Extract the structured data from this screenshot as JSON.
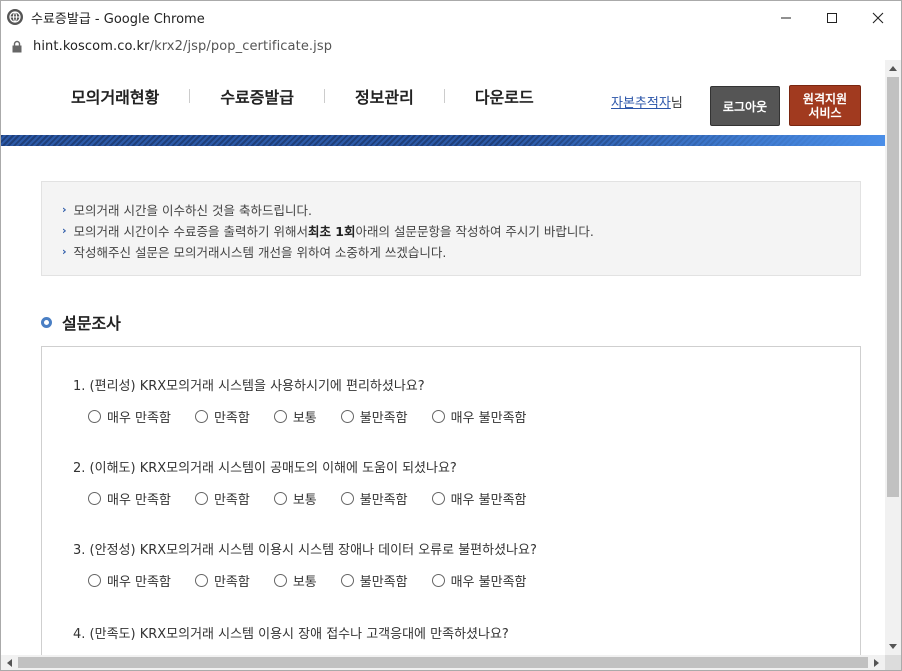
{
  "window": {
    "title": "수료증발급 - Google Chrome",
    "url_host": "hint.koscom.co.kr",
    "url_path": "/krx2/jsp/pop_certificate.jsp"
  },
  "nav": {
    "items": [
      "모의거래현황",
      "수료증발급",
      "정보관리",
      "다운로드"
    ]
  },
  "user": {
    "name": "자본추적자",
    "suffix": "님",
    "logout_label": "로그아웃",
    "remote_line1": "원격지원",
    "remote_line2": "서비스"
  },
  "notice": {
    "line1": "모의거래 시간을 이수하신 것을 축하드립니다.",
    "line2_pre": "모의거래 시간이수 수료증을 출력하기 위해서 ",
    "line2_bold": "최초 1회",
    "line2_post": " 아래의 설문문항을 작성하여 주시기 바랍니다.",
    "line3": "작성해주신 설문은 모의거래시스템 개선을 위하여 소중하게 쓰겠습니다."
  },
  "section_title": "설문조사",
  "options": [
    "매우 만족함",
    "만족함",
    "보통",
    "불만족함",
    "매우 불만족함"
  ],
  "questions": [
    "1. (편리성) KRX모의거래 시스템을 사용하시기에 편리하셨나요?",
    "2. (이해도) KRX모의거래 시스템이 공매도의 이해에 도움이 되셨나요?",
    "3. (안정성) KRX모의거래 시스템 이용시 시스템 장애나 데이터 오류로 불편하셨나요?",
    "4. (만족도) KRX모의거래 시스템 이용시 장애 접수나 고객응대에 만족하셨나요?"
  ],
  "colors": {
    "accent_blue": "#2c5aa8",
    "logout_bg": "#555555",
    "remote_bg": "#a13a1f"
  }
}
